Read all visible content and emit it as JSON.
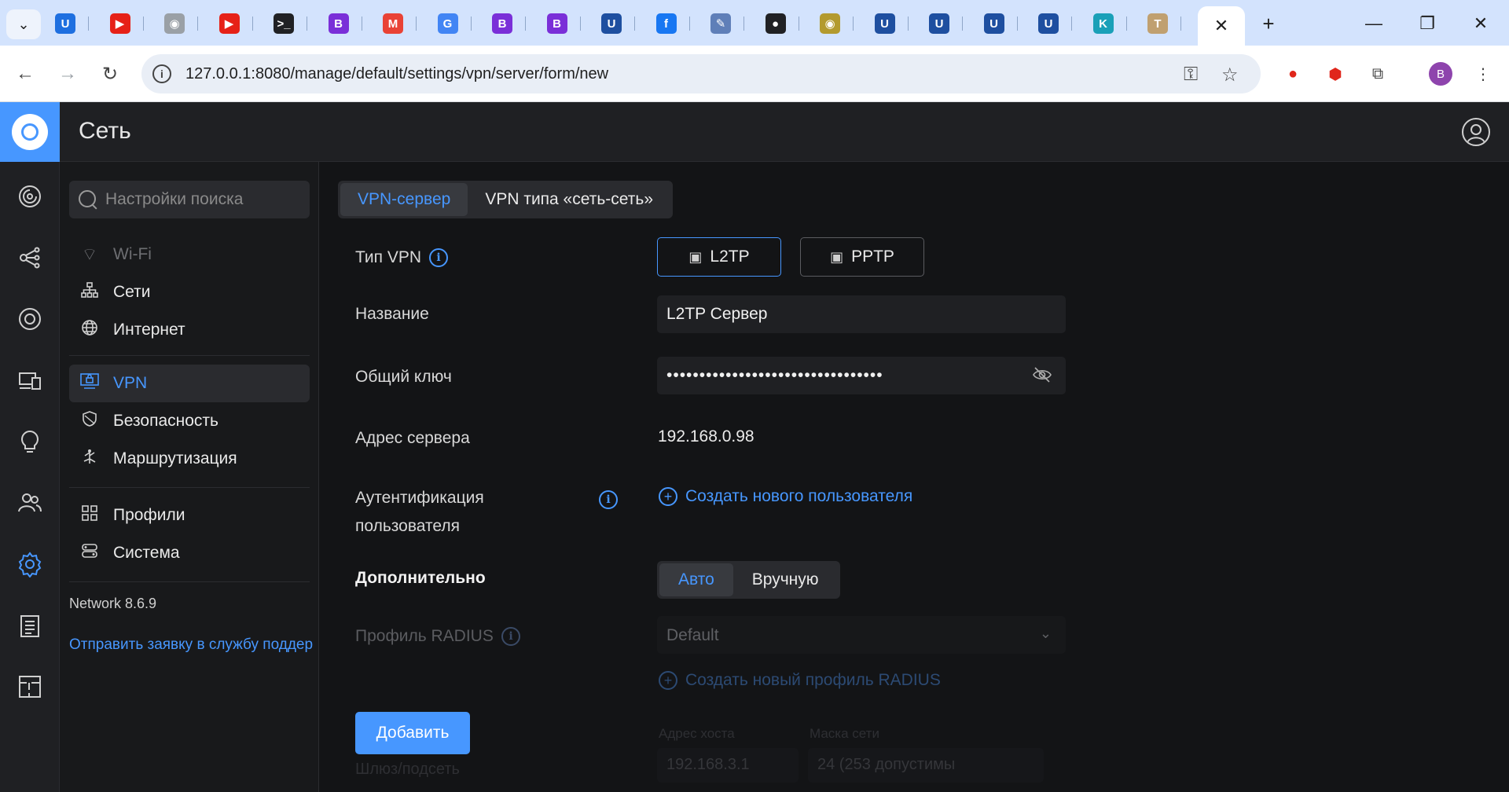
{
  "browser": {
    "url": "127.0.0.1:8080/manage/default/settings/vpn/server/form/new",
    "favicons": [
      {
        "name": "unifi-tab-icon",
        "glyph": "U",
        "color": "#1e6fe0"
      },
      {
        "name": "youtube-tab-icon",
        "glyph": "▶",
        "color": "#e62117"
      },
      {
        "name": "zoo-tab-icon",
        "glyph": "◉",
        "color": "#9aa0a6"
      },
      {
        "name": "youtube-tab-icon",
        "glyph": "▶",
        "color": "#e62117"
      },
      {
        "name": "terminal-tab-icon",
        "glyph": ">_",
        "color": "#202124"
      },
      {
        "name": "bootstrap-tab-icon",
        "glyph": "B",
        "color": "#7a2fd8"
      },
      {
        "name": "gmail-tab-icon",
        "glyph": "M",
        "color": "#e94235"
      },
      {
        "name": "google-tab-icon",
        "glyph": "G",
        "color": "#4285f4"
      },
      {
        "name": "bootstrap-tab-icon",
        "glyph": "B",
        "color": "#7a2fd8"
      },
      {
        "name": "bootstrap-tab-icon",
        "glyph": "B",
        "color": "#7a2fd8"
      },
      {
        "name": "unifi-tab-icon",
        "glyph": "U",
        "color": "#1e4fa0"
      },
      {
        "name": "facebook-tab-icon",
        "glyph": "f",
        "color": "#1877f2"
      },
      {
        "name": "tool-tab-icon",
        "glyph": "✎",
        "color": "#5f7fb8"
      },
      {
        "name": "github-tab-icon",
        "glyph": "●",
        "color": "#202124"
      },
      {
        "name": "grafana-tab-icon",
        "glyph": "◉",
        "color": "#b39a2e"
      },
      {
        "name": "unifi-tab-icon",
        "glyph": "U",
        "color": "#1e4fa0"
      },
      {
        "name": "unifi-tab-icon",
        "glyph": "U",
        "color": "#1e4fa0"
      },
      {
        "name": "unifi-tab-icon",
        "glyph": "U",
        "color": "#1e4fa0"
      },
      {
        "name": "unifi-tab-icon",
        "glyph": "U",
        "color": "#1e4fa0"
      },
      {
        "name": "kotlin-tab-icon",
        "glyph": "K",
        "color": "#1aa0b8"
      },
      {
        "name": "tilde-tab-icon",
        "glyph": "T",
        "color": "#c0a070"
      }
    ],
    "profile_initial": "B"
  },
  "app": {
    "title": "Сеть"
  },
  "sidebar": {
    "search_placeholder": "Настройки поиска",
    "items": [
      {
        "label": "Wi-Fi",
        "icon": "wifi-icon"
      },
      {
        "label": "Сети",
        "icon": "network-tree-icon"
      },
      {
        "label": "Интернет",
        "icon": "globe-icon"
      },
      {
        "label": "VPN",
        "icon": "vpn-icon"
      },
      {
        "label": "Безопасность",
        "icon": "shield-icon"
      },
      {
        "label": "Маршрутизация",
        "icon": "routing-icon"
      },
      {
        "label": "Профили",
        "icon": "profiles-icon"
      },
      {
        "label": "Система",
        "icon": "system-icon"
      }
    ],
    "version": "Network 8.6.9",
    "support_link": "Отправить заявку в службу поддер"
  },
  "main": {
    "tabs": [
      {
        "label": "VPN-сервер"
      },
      {
        "label": "VPN типа «сеть-сеть»"
      }
    ],
    "vpn_type_label": "Тип VPN",
    "vpn_types": [
      "L2TP",
      "PPTP"
    ],
    "name_label": "Название",
    "name_value": "L2TP Сервер",
    "shared_key_label": "Общий ключ",
    "shared_key_value": "•••••••••••••••••••••••••••••••••",
    "server_address_label": "Адрес сервера",
    "server_address_value": "192.168.0.98",
    "auth_label_line1": "Аутентификация",
    "auth_label_line2": "пользователя",
    "create_user_link": "Создать нового пользователя",
    "advanced_label": "Дополнительно",
    "advanced_modes": [
      "Авто",
      "Вручную"
    ],
    "radius_label": "Профиль RADIUS",
    "radius_value": "Default",
    "create_radius_link": "Создать новый профиль RADIUS",
    "host_address_label": "Адрес хоста",
    "host_address_value": "192.168.3.1",
    "netmask_label": "Маска сети",
    "netmask_value": "24 (253 допустимы",
    "gateway_label": "Шлюз/подсеть",
    "add_button": "Добавить"
  },
  "colors": {
    "accent": "#4797ff",
    "background": "#131416",
    "panel": "#1f2023"
  }
}
